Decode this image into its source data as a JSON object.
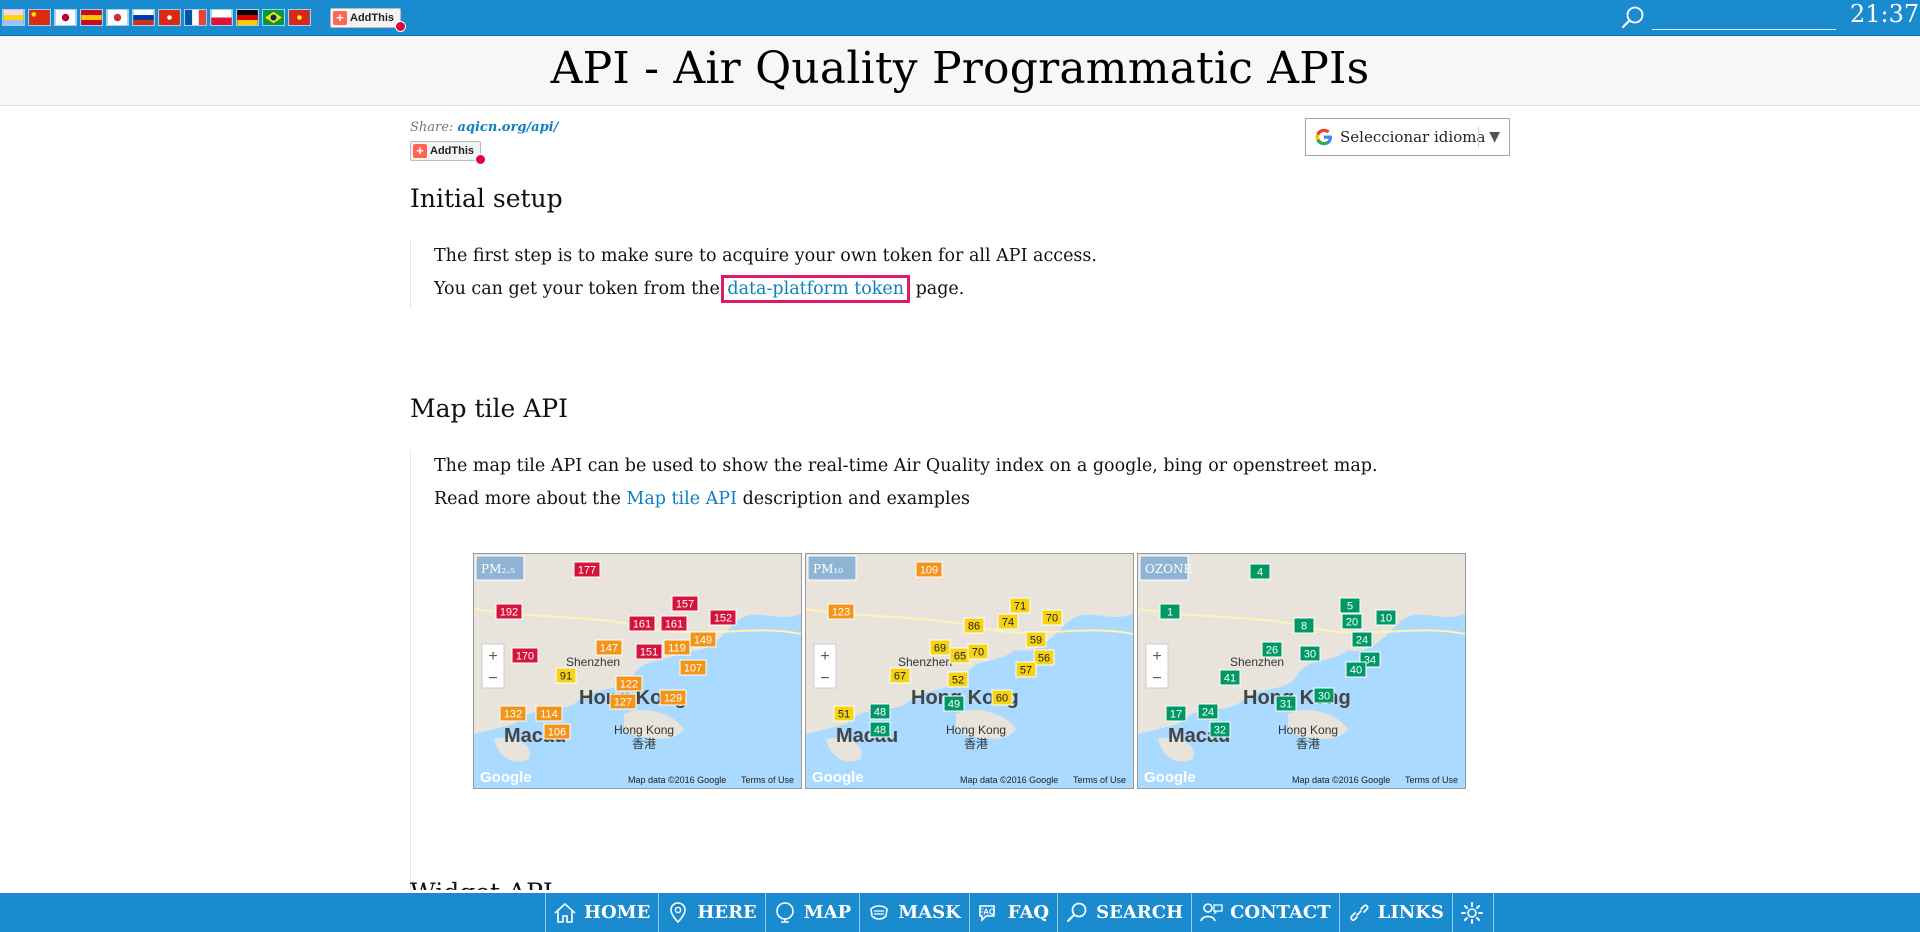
{
  "topbar": {
    "flags": [
      {
        "name": "flag-icon-th",
        "c1": "#ffd6e6",
        "c2": "#f9d900",
        "c3": "#9fbfff"
      },
      {
        "name": "flag-icon-cn",
        "c1": "#de2910",
        "c2": "#de2910",
        "c3": "#ffde00"
      },
      {
        "name": "flag-icon-jp",
        "c1": "#ffffff",
        "c2": "#ffffff",
        "c3": "#bc002d"
      },
      {
        "name": "flag-icon-es",
        "c1": "#c60b1e",
        "c2": "#ffc400",
        "c3": "#c60b1e"
      },
      {
        "name": "flag-icon-kr",
        "c1": "#ffffff",
        "c2": "#ffffff",
        "c3": "#cd2e3a"
      },
      {
        "name": "flag-icon-ru",
        "c1": "#ffffff",
        "c2": "#0039a6",
        "c3": "#d52b1e"
      },
      {
        "name": "flag-icon-hk",
        "c1": "#de2910",
        "c2": "#de2910",
        "c3": "#ffffff"
      },
      {
        "name": "flag-icon-fr",
        "c1": "#0055a4",
        "c2": "#ffffff",
        "c3": "#ef4135"
      },
      {
        "name": "flag-icon-pl",
        "c1": "#ffffff",
        "c2": "#ffffff",
        "c3": "#dc143c"
      },
      {
        "name": "flag-icon-de",
        "c1": "#000000",
        "c2": "#dd0000",
        "c3": "#ffce00"
      },
      {
        "name": "flag-icon-br",
        "c1": "#009c3b",
        "c2": "#ffdf00",
        "c3": "#002776"
      },
      {
        "name": "flag-icon-vn",
        "c1": "#da251d",
        "c2": "#da251d",
        "c3": "#ffff00"
      }
    ],
    "addthis_label": "AddThis",
    "search_icon": "search-icon",
    "search_value": "",
    "clock": "21:37"
  },
  "page": {
    "title": "API - Air Quality Programmatic APIs"
  },
  "share": {
    "prefix": "Share: ",
    "link": "aqicn.org/api/",
    "addthis_label": "AddThis"
  },
  "language": {
    "label": "Seleccionar idioma",
    "arrow": "▼"
  },
  "setup": {
    "title": "Initial setup",
    "line1": "The first step is to make sure to acquire your own token for all API access.",
    "line2_before": "You can get your token from the ",
    "line2_link": "data-platform token",
    "line2_after": " page."
  },
  "maptile": {
    "title": "Map tile API",
    "line1": "The map tile API can be used to show the real-time Air Quality index on a google, bing or openstreet map.",
    "line2_before": "Read more about the ",
    "line2_link": "Map tile API",
    "line2_after": " description and examples",
    "maps": [
      {
        "badge": "PM₂.₅",
        "values": [
          "177",
          "192",
          "157",
          "161",
          "152",
          "161",
          "149",
          "147",
          "151",
          "119",
          "170",
          "91",
          "122",
          "107",
          "129",
          "127",
          "132",
          "114",
          "106"
        ]
      },
      {
        "badge": "PM₁₀",
        "values": [
          "109",
          "123",
          "86",
          "74",
          "71",
          "70",
          "69",
          "65",
          "70",
          "59",
          "52",
          "56",
          "57",
          "67",
          "49",
          "60",
          "51",
          "48",
          "48"
        ]
      },
      {
        "badge": "OZONE",
        "values": [
          "4",
          "1",
          "8",
          "5",
          "20",
          "10",
          "24",
          "26",
          "30",
          "34",
          "41",
          "40",
          "31",
          "17",
          "24",
          "30",
          "32"
        ]
      }
    ],
    "place_labels": [
      "Hong Kong",
      "Macau",
      "Shenzhen",
      "Hong Kong",
      "香港"
    ],
    "map_credit": "Map data ©2016 Google",
    "map_terms": "Terms of Use",
    "map_brand": "Google"
  },
  "widget": {
    "title": "Widget API"
  },
  "nav": [
    {
      "label": "HOME",
      "icon": "home-icon"
    },
    {
      "label": "HERE",
      "icon": "location-pin-icon"
    },
    {
      "label": "MAP",
      "icon": "globe-icon"
    },
    {
      "label": "MASK",
      "icon": "mask-icon"
    },
    {
      "label": "FAQ",
      "icon": "faq-icon"
    },
    {
      "label": "SEARCH",
      "icon": "search-icon"
    },
    {
      "label": "CONTACT",
      "icon": "contact-icon"
    },
    {
      "label": "LINKS",
      "icon": "link-icon"
    },
    {
      "label": "",
      "icon": "gear-icon"
    }
  ],
  "colors": {
    "bar_blue": "#1a8bcf",
    "link_blue": "#0e7fc0",
    "highlight": "#e0186a",
    "aqi_red": "#d4143c",
    "aqi_orange": "#f39419",
    "aqi_yellow": "#f7d316",
    "aqi_green": "#009966"
  }
}
